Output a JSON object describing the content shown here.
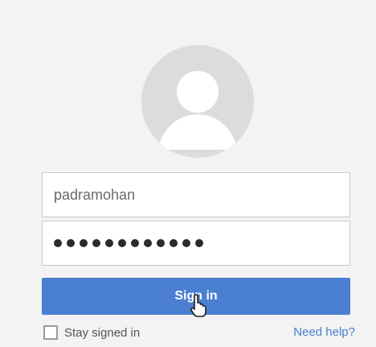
{
  "login": {
    "username_value": "padramohan",
    "password_value": "●●●●●●●●●●●●",
    "signin_label": "Sign in",
    "stay_signed_in_label": "Stay signed in",
    "need_help_label": "Need help?"
  },
  "icons": {
    "avatar": "user-avatar-icon",
    "cursor": "hand-pointer-icon"
  },
  "colors": {
    "primary": "#4b7fd1",
    "background": "#f1f1f1",
    "avatar_bg": "#dcdcdc",
    "avatar_fg": "#ffffff"
  }
}
